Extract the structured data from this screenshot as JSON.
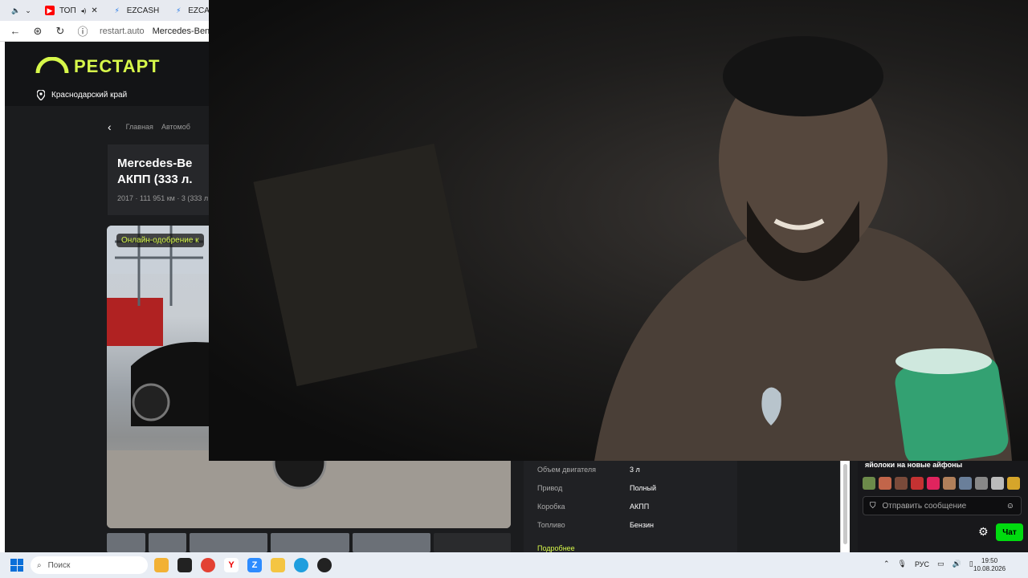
{
  "browser": {
    "tabs": [
      {
        "label": "",
        "icon": "speaker-icon"
      },
      {
        "label": "ТОП",
        "icon": "youtube-icon"
      },
      {
        "label": "EZCASH",
        "icon": "ezcash-icon"
      },
      {
        "label": "EZCASH",
        "icon": "ezcash-icon"
      }
    ],
    "url": "restart.auto",
    "page_title": "Mercedes-Benz"
  },
  "site": {
    "logo": "РЕСТАРТ",
    "region": "Краснодарский край",
    "breadcrumbs": [
      "Главная",
      "Автомоб"
    ],
    "car_title_line1": "Mercedes-Be",
    "car_title_line2": "АКПП (333 л.",
    "car_subtitle": "2017 · 111 951 км · 3 (333 л",
    "photo_badge": "Онлайн-одобрение к",
    "specs": [
      {
        "label": "Объем двигателя",
        "value": "3 л"
      },
      {
        "label": "Привод",
        "value": "Полный"
      },
      {
        "label": "Коробка",
        "value": "АКПП"
      },
      {
        "label": "Топливо",
        "value": "Бензин"
      }
    ],
    "more_link": "Подробнее",
    "accent": "#d7f84a"
  },
  "chat": {
    "last_message": "яйолоки на новые айфоны",
    "input_placeholder": "Отправить сообщение",
    "send_label": "Чат",
    "accent": "#00db0f"
  },
  "taskbar": {
    "search_placeholder": "Поиск",
    "language": "РУС",
    "time": "19:50",
    "date": "10.08.2026"
  }
}
